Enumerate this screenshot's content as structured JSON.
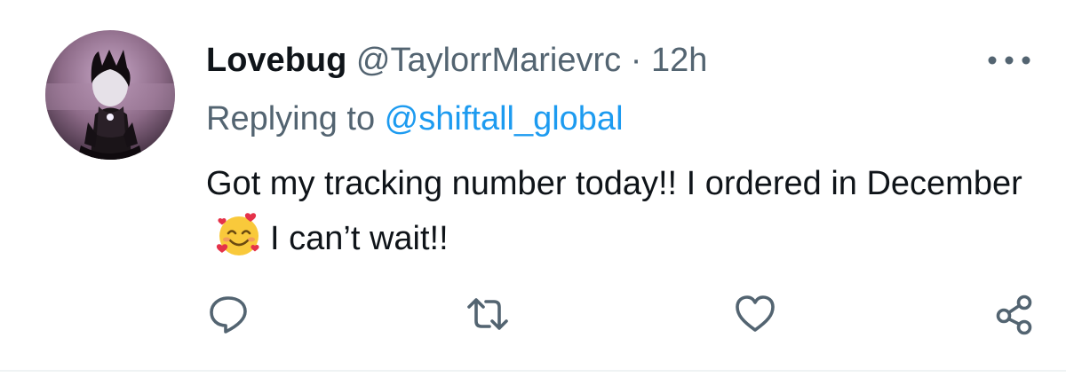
{
  "tweet": {
    "author_name": "Lovebug",
    "author_handle": "@TaylorrMarievrc",
    "separator": " · ",
    "timestamp": "12h",
    "replying_prefix": "Replying to ",
    "replying_to": "@shiftall_global",
    "text_part1": "Got my tracking number today!! I ordered in December",
    "emoji": "smiling-face-with-hearts",
    "text_part2": "I can’t wait!!"
  },
  "icons": {
    "more": "more-horizontal-icon",
    "reply": "reply-icon",
    "retweet": "retweet-icon",
    "like": "heart-icon",
    "share": "share-icon"
  },
  "colors": {
    "text_primary": "#0f1419",
    "text_secondary": "#536471",
    "link": "#1d9bf0",
    "divider": "#eff3f4"
  }
}
